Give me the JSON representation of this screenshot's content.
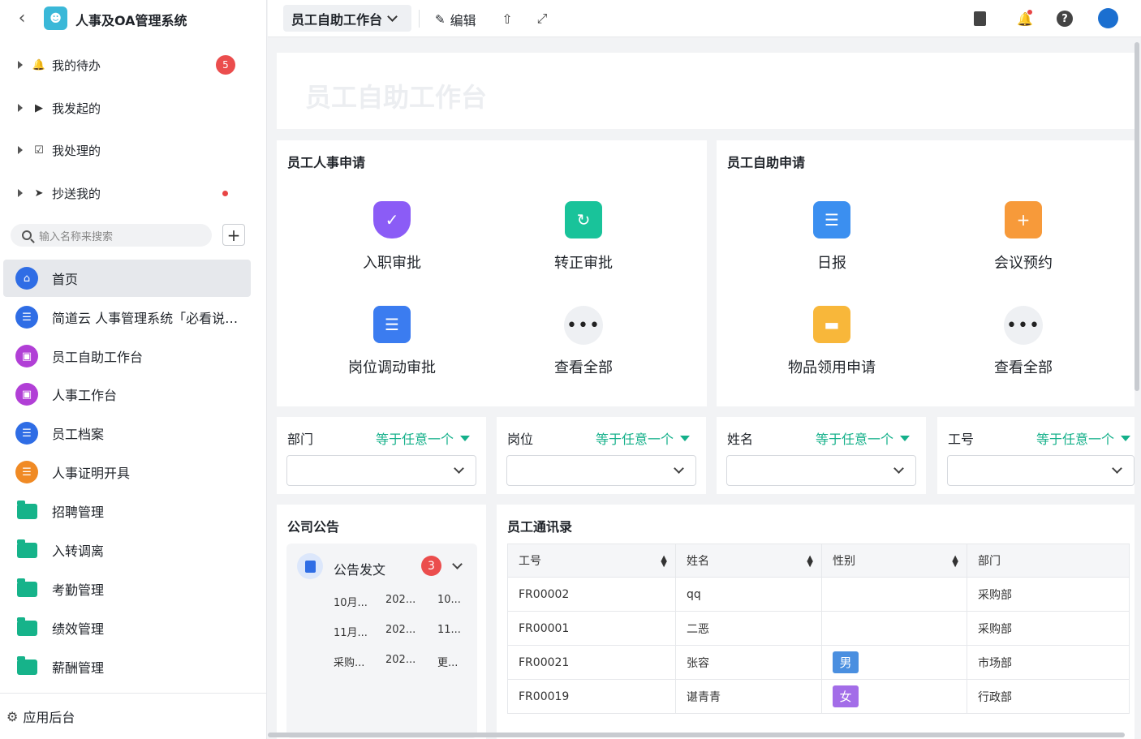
{
  "app": {
    "title": "人事及OA管理系统"
  },
  "sidebar": {
    "groups": [
      {
        "label": "我的待办",
        "badge": "5"
      },
      {
        "label": "我发起的"
      },
      {
        "label": "我处理的"
      },
      {
        "label": "抄送我的"
      }
    ],
    "search_placeholder": "输入名称来搜索",
    "items": [
      {
        "label": "首页",
        "icon": "home-icon",
        "color": "#2f6de5"
      },
      {
        "label": "简道云 人事管理系统「必看说明」",
        "icon": "document-icon",
        "color": "#2f6de5"
      },
      {
        "label": "员工自助工作台",
        "icon": "dashboard-icon",
        "color": "#b13fd6"
      },
      {
        "label": "人事工作台",
        "icon": "dashboard-icon",
        "color": "#b13fd6"
      },
      {
        "label": "员工档案",
        "icon": "document-icon",
        "color": "#2f6de5"
      },
      {
        "label": "人事证明开具",
        "icon": "document-icon",
        "color": "#f08a24"
      },
      {
        "label": "招聘管理",
        "icon": "folder-icon"
      },
      {
        "label": "入转调离",
        "icon": "folder-icon"
      },
      {
        "label": "考勤管理",
        "icon": "folder-icon"
      },
      {
        "label": "绩效管理",
        "icon": "folder-icon"
      },
      {
        "label": "薪酬管理",
        "icon": "folder-icon"
      }
    ],
    "footer": "应用后台"
  },
  "topbar": {
    "page_name": "员工自助工作台",
    "edit_label": "编辑"
  },
  "hero": {
    "title": "员工自助工作台"
  },
  "hr_apply": {
    "title": "员工人事申请",
    "tiles": [
      {
        "label": "入职审批",
        "icon": "shield-check-icon",
        "color": "#8b5cf6"
      },
      {
        "label": "转正审批",
        "icon": "bookmark-icon",
        "color": "#19c39a"
      },
      {
        "label": "岗位调动审批",
        "icon": "clipboard-icon",
        "color": "#3b7cf0"
      },
      {
        "label": "查看全部",
        "icon": "more-icon"
      }
    ]
  },
  "self_apply": {
    "title": "员工自助申请",
    "tiles": [
      {
        "label": "日报",
        "icon": "clipboard-icon",
        "color": "#3b8ff0"
      },
      {
        "label": "会议预约",
        "icon": "inbox-plus-icon",
        "color": "#f79a3a"
      },
      {
        "label": "物品领用申请",
        "icon": "folder-icon",
        "color": "#f8b73a"
      },
      {
        "label": "查看全部",
        "icon": "more-icon"
      }
    ]
  },
  "filters": [
    {
      "label": "部门",
      "op": "等于任意一个"
    },
    {
      "label": "岗位",
      "op": "等于任意一个"
    },
    {
      "label": "姓名",
      "op": "等于任意一个"
    },
    {
      "label": "工号",
      "op": "等于任意一个"
    }
  ],
  "announcements": {
    "title": "公司公告",
    "category": "公告发文",
    "count": "3",
    "rows": [
      [
        "10月...",
        "202...",
        "10..."
      ],
      [
        "11月...",
        "202...",
        "11..."
      ],
      [
        "采购...",
        "202...",
        "更..."
      ]
    ]
  },
  "directory": {
    "title": "员工通讯录",
    "columns": [
      "工号",
      "姓名",
      "性别",
      "部门"
    ],
    "rows": [
      {
        "id": "FR00002",
        "name": "qq",
        "gender": "",
        "dept": "采购部"
      },
      {
        "id": "FR00001",
        "name": "二恶",
        "gender": "",
        "dept": "采购部"
      },
      {
        "id": "FR00021",
        "name": "张容",
        "gender": "男",
        "dept": "市场部"
      },
      {
        "id": "FR00019",
        "name": "谌青青",
        "gender": "女",
        "dept": "行政部"
      }
    ],
    "gender_colors": {
      "男": "#4a8fe0",
      "女": "#a36de8"
    }
  }
}
